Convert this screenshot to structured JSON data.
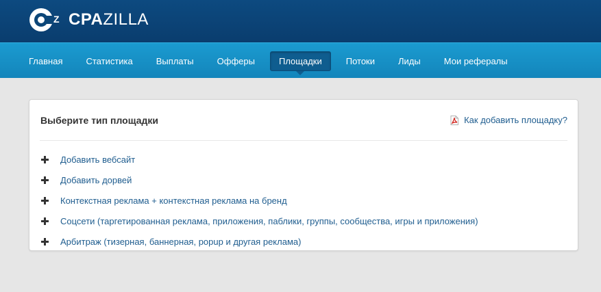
{
  "brand": {
    "logo_letter": "Z",
    "name_bold": "CPA",
    "name_light": "ZILLA"
  },
  "nav": {
    "items": [
      {
        "label": "Главная"
      },
      {
        "label": "Статистика"
      },
      {
        "label": "Выплаты"
      },
      {
        "label": "Офферы"
      },
      {
        "label": "Площадки",
        "active": true
      },
      {
        "label": "Потоки"
      },
      {
        "label": "Лиды"
      },
      {
        "label": "Мои рефералы"
      }
    ]
  },
  "panel": {
    "title": "Выберите тип площадки",
    "help_link": "Как добавить площадку?",
    "help_icon": "pdf-icon",
    "options": [
      {
        "label": "Добавить вебсайт",
        "icon": "plus-icon"
      },
      {
        "label": "Добавить дорвей",
        "icon": "plus-icon"
      },
      {
        "label": "Контекстная реклама + контекстная реклама на бренд",
        "icon": "plus-icon"
      },
      {
        "label": "Соцсети (таргетированная реклама, приложения, паблики, группы, сообщества, игры и приложения)",
        "icon": "plus-icon"
      },
      {
        "label": "Арбитраж (тизерная, баннерная, popup и другая реклама)",
        "icon": "plus-icon"
      }
    ]
  },
  "colors": {
    "topbar": "#0b4475",
    "navbar": "#1790c6",
    "nav_active": "#0f5d8f",
    "link": "#1f5d8f",
    "background": "#e6e6e6"
  }
}
